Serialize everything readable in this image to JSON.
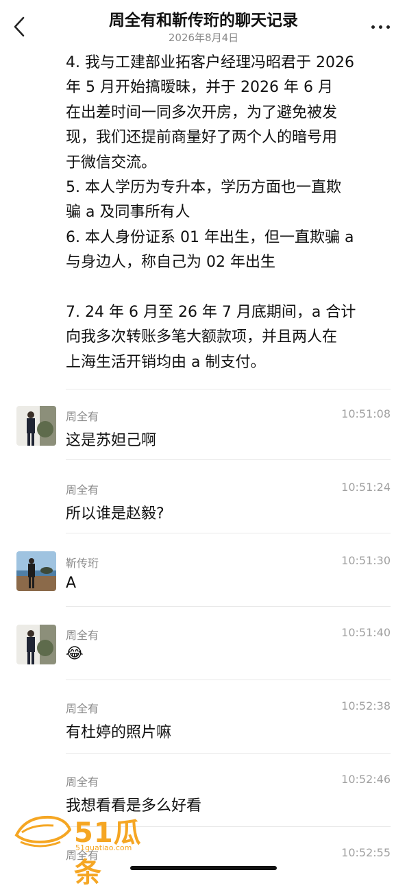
{
  "header": {
    "title": "周全有和靳传珩的聊天记录",
    "date": "2026年8月4日",
    "back_icon": "chevron-left-icon",
    "more_icon": "more-dots-icon"
  },
  "quote_lines": [
    "4. 我与工建部业拓客户经理冯昭君于 2026",
    "年 5 月开始搞暧昧，并于 2026 年 6 月",
    "在出差时间一同多次开房，为了避免被发",
    "现，我们还提前商量好了两个人的暗号用",
    "于微信交流。",
    "5. 本人学历为专升本，学历方面也一直欺",
    "骗 a 及同事所有人",
    "6. 本人身份证系 01 年出生，但一直欺骗 a",
    "与身边人，称自己为 02 年出生",
    "",
    "7. 24 年 6 月至 26 年 7 月底期间，a 合计",
    "向我多次转账多笔大额款项，并且两人在",
    "上海生活开销均由 a 制支付。"
  ],
  "messages": [
    {
      "sender": "周全有",
      "time": "10:51:08",
      "text": "这是苏妲己啊",
      "avatar": true
    },
    {
      "sender": "周全有",
      "time": "10:51:24",
      "text": "所以谁是赵毅?",
      "avatar": false
    },
    {
      "sender": "靳传珩",
      "time": "10:51:30",
      "text": "A",
      "avatar": true
    },
    {
      "sender": "周全有",
      "time": "10:51:40",
      "text": "😂",
      "avatar": true
    },
    {
      "sender": "周全有",
      "time": "10:52:38",
      "text": "有杜婷的照片嘛",
      "avatar": false
    },
    {
      "sender": "周全有",
      "time": "10:52:46",
      "text": "我想看看是多么好看",
      "avatar": false
    },
    {
      "sender": "周全有",
      "time": "10:52:55",
      "text": "",
      "avatar": false
    }
  ],
  "watermark": {
    "brand": "51瓜条",
    "url": "51guatiao.com"
  },
  "colors": {
    "background": "#ffffff",
    "text": "#111111",
    "meta": "#8b8b8b",
    "watermark": "#f5a623"
  }
}
